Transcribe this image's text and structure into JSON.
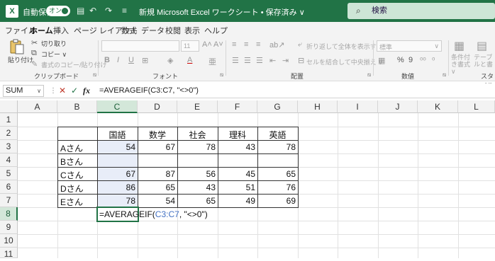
{
  "titlebar": {
    "autosave_label": "自動保存",
    "toggle_label": "オン",
    "document_title": "新規 Microsoft Excel ワークシート • 保存済み ∨",
    "search_placeholder": "検索"
  },
  "menu": {
    "tabs": [
      "ファイル",
      "ホーム",
      "挿入",
      "ページ レイアウト",
      "数式",
      "データ",
      "校閲",
      "表示",
      "ヘルプ"
    ],
    "active_tab": "ホーム"
  },
  "ribbon": {
    "paste_label": "貼り付け",
    "cut_label": "切り取り",
    "copy_label": "コピー ∨",
    "format_painter_label": "書式のコピー/貼り付け",
    "font_size": "11",
    "wrap_text_label": "折り返して全体を表示する",
    "merge_center_label": "セルを結合して中央揃え ∨",
    "number_format": "標準",
    "conditional_format_label": "条件付き書式 ∨",
    "table_format_label": "テーブルと書式設定",
    "group_labels": {
      "clipboard": "クリップボード",
      "font": "フォント",
      "alignment": "配置",
      "number": "数値",
      "styles": "スタイル"
    }
  },
  "formula_bar": {
    "name_box": "SUM",
    "fx": "fx",
    "formula": "=AVERAGEIF(C3:C7, \"<>0\")"
  },
  "sheet": {
    "columns": [
      "A",
      "B",
      "C",
      "D",
      "E",
      "F",
      "G",
      "H",
      "I",
      "J",
      "K",
      "L"
    ],
    "rows": [
      "1",
      "2",
      "3",
      "4",
      "5",
      "6",
      "7",
      "8",
      "9",
      "10",
      "11"
    ],
    "selected_column": "C",
    "selected_row": "8",
    "table": {
      "headers": [
        "国語",
        "数学",
        "社会",
        "理科",
        "英語"
      ],
      "rows": [
        {
          "name": "Aさん",
          "values": [
            "54",
            "67",
            "78",
            "43",
            "78"
          ]
        },
        {
          "name": "Bさん",
          "values": [
            "",
            "",
            "",
            "",
            ""
          ]
        },
        {
          "name": "Cさん",
          "values": [
            "67",
            "87",
            "56",
            "45",
            "65"
          ]
        },
        {
          "name": "Dさん",
          "values": [
            "86",
            "65",
            "43",
            "51",
            "76"
          ]
        },
        {
          "name": "Eさん",
          "values": [
            "78",
            "54",
            "65",
            "49",
            "69"
          ]
        }
      ]
    },
    "editing_cell": {
      "prefix": "=AVERAGEIF(",
      "ref": "C3:C7",
      "suffix": ", \"<>0\")"
    }
  },
  "colors": {
    "accent": "#217346",
    "reference": "#4472c4"
  }
}
